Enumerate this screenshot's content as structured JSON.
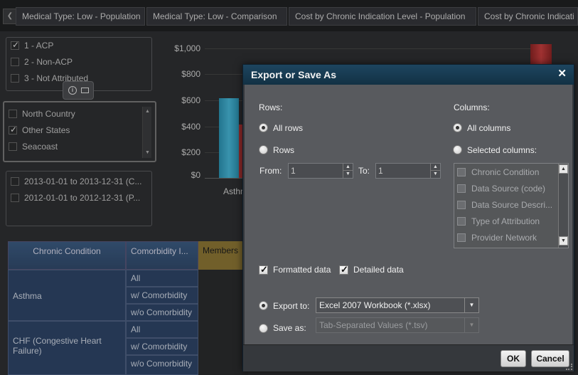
{
  "tabs": [
    {
      "label": "Medical Type: Low - Population"
    },
    {
      "label": "Medical Type: Low - Comparison"
    },
    {
      "label": "Cost by Chronic Indication Level - Population"
    },
    {
      "label": "Cost by Chronic Indicati"
    }
  ],
  "filters": {
    "attribution": [
      {
        "label": "1 - ACP",
        "checked": true
      },
      {
        "label": "2 - Non-ACP",
        "checked": false
      },
      {
        "label": "3 - Not Attributed",
        "checked": false
      }
    ],
    "region": [
      {
        "label": "North Country",
        "checked": false
      },
      {
        "label": "Other States",
        "checked": true
      },
      {
        "label": "Seacoast",
        "checked": false
      }
    ],
    "period": [
      {
        "label": "2013-01-01 to 2013-12-31 (C...",
        "checked": false
      },
      {
        "label": "2012-01-01 to 2012-12-31 (P...",
        "checked": false
      }
    ]
  },
  "chart": {
    "y_ticks": [
      "$1,000",
      "$800",
      "$600",
      "$400",
      "$200",
      "$0"
    ],
    "x_label_partial": "Asthm"
  },
  "table": {
    "headers": {
      "chronic_condition": "Chronic Condition",
      "comorbidity": "Comorbidity I...",
      "members": "Members"
    },
    "groups": [
      {
        "condition": "Asthma",
        "rows": [
          "All",
          "w/ Comorbidity",
          "w/o Comorbidity"
        ]
      },
      {
        "condition": "CHF (Congestive Heart Failure)",
        "rows": [
          "All",
          "w/ Comorbidity",
          "w/o Comorbidity"
        ]
      }
    ]
  },
  "dialog": {
    "title": "Export or Save As",
    "close_glyph": "✕",
    "rows_label": "Rows:",
    "columns_label": "Columns:",
    "all_rows": "All rows",
    "rows": "Rows",
    "from_label": "From:",
    "to_label": "To:",
    "from_value": "1",
    "to_value": "1",
    "all_columns": "All columns",
    "selected_columns": "Selected columns:",
    "column_items": [
      "Chronic Condition",
      "Data Source (code)",
      "Data Source Descri...",
      "Type of Attribution",
      "Provider Network"
    ],
    "formatted_data": "Formatted data",
    "detailed_data": "Detailed data",
    "export_to": "Export to:",
    "export_format": "Excel 2007 Workbook (*.xlsx)",
    "save_as": "Save as:",
    "save_format": "Tab-Separated Values (*.tsv)",
    "ok": "OK",
    "cancel": "Cancel"
  },
  "colors": {
    "title_bar": "#123144",
    "dialog_body": "#585a5e",
    "table_header": "#3b5a80",
    "members_header": "#8a7534"
  }
}
